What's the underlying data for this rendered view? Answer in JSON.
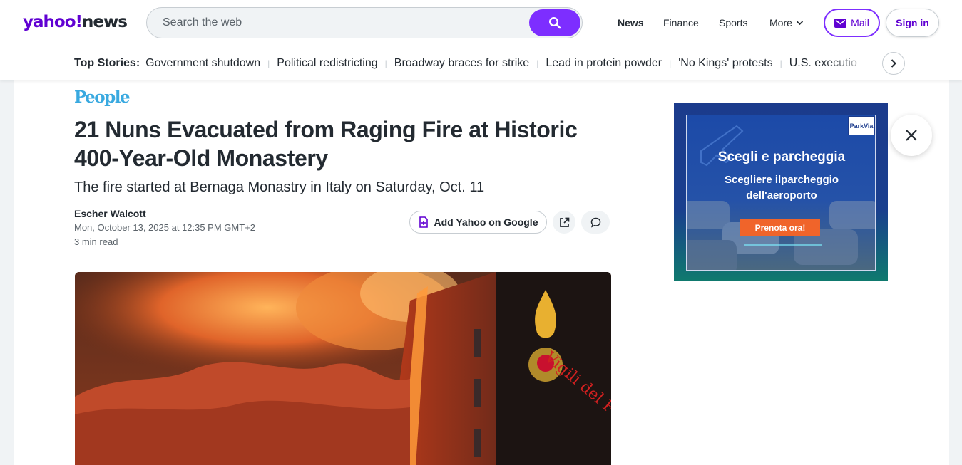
{
  "header": {
    "logo_yahoo": "yahoo!",
    "logo_news": "news",
    "search_placeholder": "Search the web",
    "nav": [
      {
        "label": "News"
      },
      {
        "label": "Finance"
      },
      {
        "label": "Sports"
      },
      {
        "label": "More"
      }
    ],
    "mail_label": "Mail",
    "signin_label": "Sign in"
  },
  "top_stories": {
    "label": "Top Stories:",
    "items": [
      "Government shutdown",
      "Political redistricting",
      "Broadway braces for strike",
      "Lead in protein powder",
      "'No Kings' protests",
      "U.S. executio"
    ]
  },
  "article": {
    "source": "People",
    "headline": "21 Nuns Evacuated from Raging Fire at Historic 400-Year-Old Monastery",
    "subheadline": "The fire started at Bernaga Monastry in Italy on Saturday, Oct. 11",
    "author": "Escher Walcott",
    "date": "Mon, October 13, 2025 at 12:35 PM GMT+2",
    "read_time": "3 min read",
    "add_yahoo_label": "Add Yahoo on Google",
    "hero_watermark": "Vigili del Fuoco"
  },
  "ad": {
    "title": "Scegli e parcheggia",
    "subtitle_line1": "Scegliere ilparcheggio",
    "subtitle_line2": "dell'aeroporto",
    "cta": "Prenota ora!",
    "brand": "ParkVia"
  },
  "colors": {
    "yahoo_purple": "#6001d2",
    "button_purple": "#7d2eff",
    "people_blue": "#39a9e0",
    "ad_cta_orange": "#f0642a"
  }
}
